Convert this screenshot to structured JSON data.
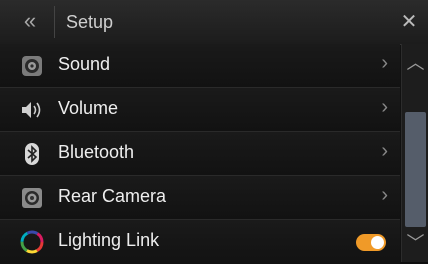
{
  "header": {
    "back_glyph": "«",
    "title": "Setup",
    "close_glyph": "✕"
  },
  "items": [
    {
      "label": "Sound",
      "icon": "speaker-icon",
      "trailing": "›"
    },
    {
      "label": "Volume",
      "icon": "volume-icon",
      "trailing": "›"
    },
    {
      "label": "Bluetooth",
      "icon": "bluetooth-icon",
      "trailing": "›"
    },
    {
      "label": "Rear Camera",
      "icon": "camera-icon",
      "trailing": "›"
    },
    {
      "label": "Lighting Link",
      "icon": "color-wheel-icon",
      "toggle": "on"
    }
  ],
  "scrollbar": {
    "up_glyph": "︿",
    "down_glyph": "﹀"
  },
  "colors": {
    "toggle_on": "#f09a28",
    "background": "#111111"
  }
}
